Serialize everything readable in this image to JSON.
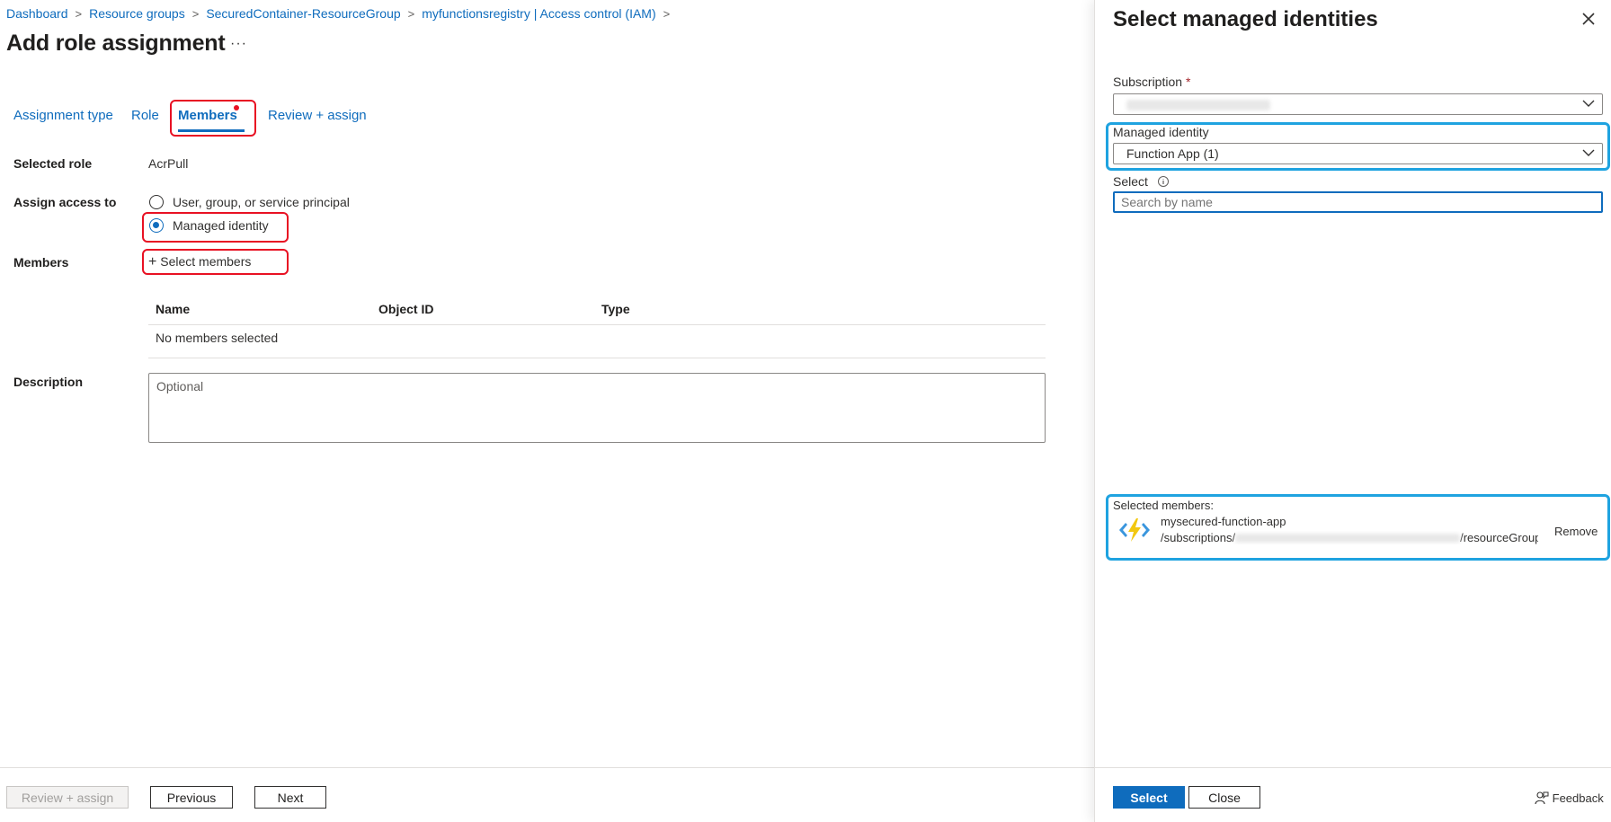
{
  "breadcrumb": {
    "items": [
      "Dashboard",
      "Resource groups",
      "SecuredContainer-ResourceGroup",
      "myfunctionsregistry | Access control (IAM)"
    ]
  },
  "page": {
    "title": "Add role assignment",
    "more": "···"
  },
  "tabs": [
    {
      "label": "Assignment type"
    },
    {
      "label": "Role"
    },
    {
      "label": "Members"
    },
    {
      "label": "Review + assign"
    }
  ],
  "form": {
    "selected_role_label": "Selected role",
    "selected_role_value": "AcrPull",
    "assign_access_label": "Assign access to",
    "option_user": "User, group, or service principal",
    "option_managed": "Managed identity",
    "members_label": "Members",
    "select_members": "Select members",
    "select_members_prefix": "+",
    "table_headers": [
      "Name",
      "Object ID",
      "Type"
    ],
    "table_empty": "No members selected",
    "description_label": "Description",
    "description_placeholder": "Optional"
  },
  "footer": {
    "review_assign": "Review + assign",
    "previous": "Previous",
    "next": "Next"
  },
  "panel": {
    "title": "Select managed identities",
    "subscription_label": "Subscription",
    "required_mark": "*",
    "managed_identity_label": "Managed identity",
    "managed_identity_value": "Function App (1)",
    "select_label": "Select",
    "search_placeholder": "Search by name",
    "selected_members_label": "Selected members:",
    "member_name": "mysecured-function-app",
    "member_path_prefix": "/subscriptions/",
    "member_path_suffix": "/resourceGroups/...",
    "remove": "Remove",
    "select_button": "Select",
    "close_button": "Close",
    "feedback": "Feedback"
  },
  "colors": {
    "accent": "#0f6cbd",
    "highlight_red": "#e81123",
    "highlight_blue": "#1fa3e0",
    "function_icon": "#f2c811"
  }
}
